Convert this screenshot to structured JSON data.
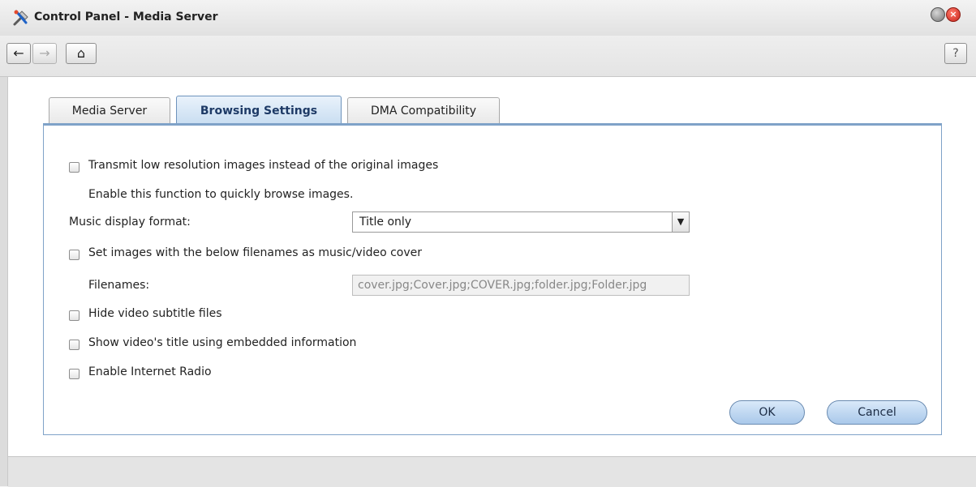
{
  "window": {
    "title": "Control Panel - Media Server",
    "app_icon": "tools-icon",
    "minimize_icon": "minimize-icon",
    "close_icon": "close-icon",
    "close_glyph": "×"
  },
  "toolbar": {
    "back_glyph": "←",
    "forward_glyph": "→",
    "home_glyph": "⌂",
    "help_glyph": "?"
  },
  "tabs": [
    {
      "label": "Media Server",
      "active": false
    },
    {
      "label": "Browsing Settings",
      "active": true
    },
    {
      "label": "DMA Compatibility",
      "active": false
    }
  ],
  "settings": {
    "low_res": {
      "label": "Transmit low resolution images instead of the original images",
      "checked": false
    },
    "low_res_hint": "Enable this function to quickly browse images.",
    "music_format": {
      "label": "Music display format:",
      "value": "Title only"
    },
    "cover": {
      "label": "Set images with the below filenames as music/video cover",
      "checked": false
    },
    "filenames": {
      "label": "Filenames:",
      "value": "cover.jpg;Cover.jpg;COVER.jpg;folder.jpg;Folder.jpg"
    },
    "hide_subtitles": {
      "label": "Hide video subtitle files",
      "checked": false
    },
    "embedded_title": {
      "label": "Show video's title using embedded information",
      "checked": false
    },
    "internet_radio": {
      "label": "Enable Internet Radio",
      "checked": false
    }
  },
  "buttons": {
    "ok": "OK",
    "cancel": "Cancel"
  },
  "colors": {
    "accent": "#7fa2c8",
    "active_tab": "#c8ddf1"
  }
}
